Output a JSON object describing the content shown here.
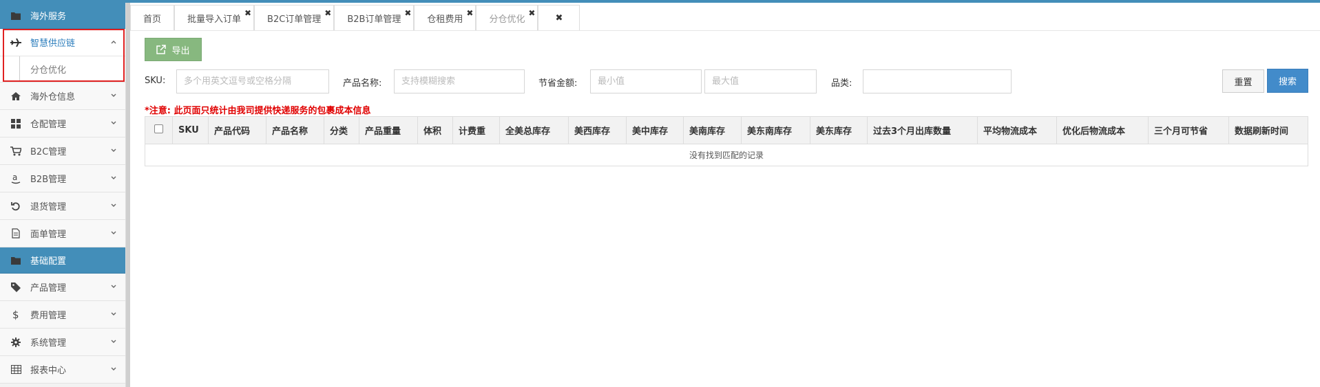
{
  "sidebar": {
    "sections": [
      {
        "label": "海外服务",
        "icon": "folder-icon"
      },
      {
        "label": "基础配置",
        "icon": "folder-icon"
      }
    ],
    "items_top": [
      {
        "label": "智慧供应链",
        "icon": "plane-icon"
      },
      {
        "label": "海外仓信息",
        "icon": "home-icon"
      },
      {
        "label": "仓配管理",
        "icon": "grid-icon"
      },
      {
        "label": "B2C管理",
        "icon": "cart-icon"
      },
      {
        "label": "B2B管理",
        "icon": "amazon-icon"
      },
      {
        "label": "退货管理",
        "icon": "undo-icon"
      },
      {
        "label": "面单管理",
        "icon": "file-icon"
      }
    ],
    "subitem": "分仓优化",
    "items_bottom": [
      {
        "label": "产品管理",
        "icon": "tag-icon"
      },
      {
        "label": "费用管理",
        "icon": "dollar-icon"
      },
      {
        "label": "系统管理",
        "icon": "gear-icon"
      },
      {
        "label": "报表中心",
        "icon": "table-icon"
      }
    ]
  },
  "tabs": [
    "首页",
    "批量导入订单",
    "B2C订单管理",
    "B2B订单管理",
    "仓租费用",
    "分仓优化"
  ],
  "toolbar": {
    "export_label": "导出"
  },
  "filters": {
    "sku_label": "SKU:",
    "sku_placeholder": "多个用英文逗号或空格分隔",
    "name_label": "产品名称:",
    "name_placeholder": "支持模糊搜索",
    "saving_label": "节省金额:",
    "min_placeholder": "最小值",
    "max_placeholder": "最大值",
    "category_label": "品类:",
    "reset_label": "重置",
    "search_label": "搜索"
  },
  "notice": "*注意: 此页面只统计由我司提供快递服务的包裹成本信息",
  "table": {
    "columns": [
      "SKU",
      "产品代码",
      "产品名称",
      "分类",
      "产品重量",
      "体积",
      "计费重",
      "全美总库存",
      "美西库存",
      "美中库存",
      "美南库存",
      "美东南库存",
      "美东库存",
      "过去3个月出库数量",
      "平均物流成本",
      "优化后物流成本",
      "三个月可节省",
      "数据刷新时间"
    ],
    "empty_text": "没有找到匹配的记录"
  },
  "colors": {
    "primary": "#438eb9",
    "export": "#87b87f",
    "search": "#428bca",
    "notice": "#e00000",
    "highlight": "#e02020"
  }
}
